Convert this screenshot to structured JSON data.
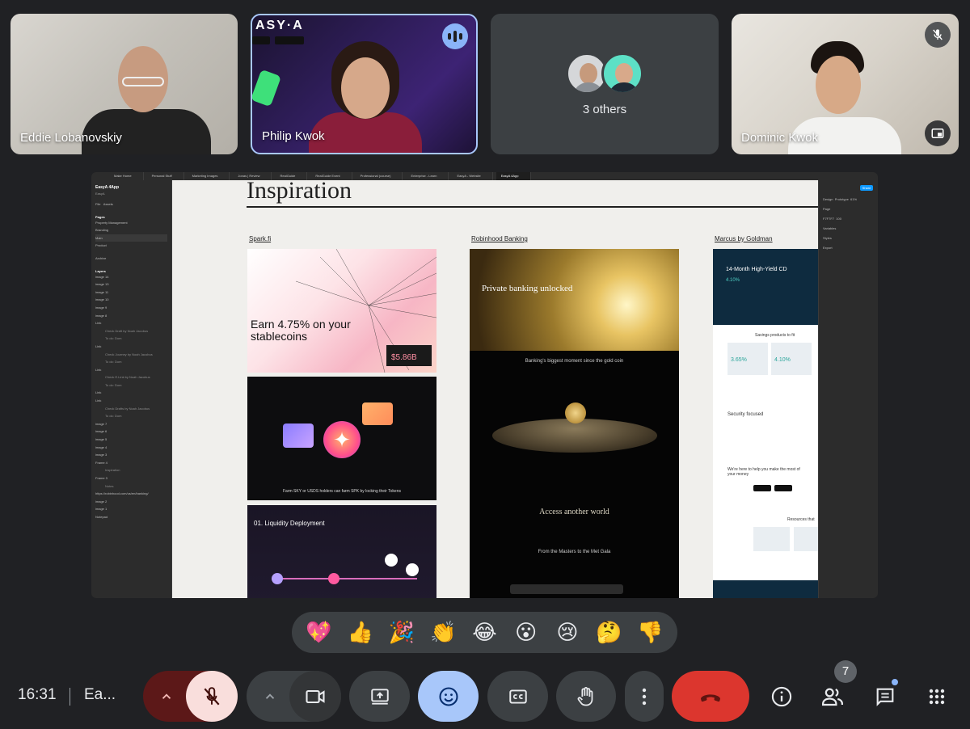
{
  "participants": [
    {
      "name": "Eddie Lobanovskiy"
    },
    {
      "name": "Philip Kwok",
      "banner": "ASY·A"
    },
    {
      "label": "3 others"
    },
    {
      "name": "Dominic Kwok"
    }
  ],
  "presentation": {
    "tabs": [
      "Make Home",
      "Personal Stuff",
      "Marketing Images",
      "Jonas | Review",
      "RealGuide",
      "RealGuide Event",
      "Professional (course)",
      "Enterprise - Learn",
      "EasyA - Website",
      "EasyA 4App"
    ],
    "file": {
      "title": "EasyA 4App",
      "subtitle": "EasyA"
    },
    "left_panel": {
      "tabs": [
        "File",
        "Assets"
      ],
      "pages_label": "Pages",
      "pages": [
        "Property Management",
        "Branding",
        "Main",
        "Product"
      ],
      "archive": "Archive",
      "layers_label": "Layers",
      "layers": [
        "image 14",
        "image 13",
        "image 11",
        "image 10",
        "image 9",
        "image 8",
        "Link",
        "Check Draft by Noah Jacobus",
        "To do: Dom",
        "Link",
        "Check Journey by Noah Jacobus",
        "To do: Dom",
        "Link",
        "Check E.Link by Noah Jacobus",
        "To do: Dom",
        "Link",
        "Link",
        "Check Drafts by Noah Jacobus",
        "To do: Dom",
        "image 7",
        "image 6",
        "image 5",
        "image 4",
        "image 3",
        "Frame 4",
        "Inspiration",
        "Frame 3",
        "Notes",
        "https://robinhood.com/us/en/banking/",
        "image 2",
        "image 1",
        "Notepad"
      ]
    },
    "right_panel": {
      "tabs": [
        "Design",
        "Prototype"
      ],
      "zoom": "61%",
      "share": "Share",
      "rows": [
        "Page",
        "F7F7F7",
        "100",
        "Variables",
        "Styles",
        "Export"
      ]
    },
    "canvas": {
      "title": "Inspiration",
      "columns": [
        {
          "label": "Spark.fi"
        },
        {
          "label": "Robinhood Banking"
        },
        {
          "label": "Marcus by Goldman"
        }
      ],
      "spark": {
        "hero": "Earn 4.75% on your stablecoins",
        "value": "$5.86B",
        "caption": "Farm SKY or USDS holders can farm SPK by locking their Tokens",
        "section": "01. Liquidity Deployment"
      },
      "robinhood": {
        "hero": "Private banking unlocked",
        "moment": "Banking's biggest moment since the gold coin",
        "access": "Access another world",
        "footer": "From the Masters to the Met Gala"
      },
      "marcus": {
        "hero": "14-Month High-Yield CD",
        "rate": "4.10%",
        "rate_alt": "3.65%",
        "rate_alt2": "4.10%",
        "savings": "Savings products to fit",
        "security": "Security focused",
        "help": "We're here to help you make the most of your money",
        "resources": "Resources that"
      }
    }
  },
  "reactions": [
    "💖",
    "👍",
    "🎉",
    "👏",
    "😂",
    "😮",
    "😢",
    "🤔",
    "👎"
  ],
  "bottom_bar": {
    "time": "16:31",
    "meeting": "Ea..."
  },
  "people_count": "7",
  "colors": {
    "background": "#202124",
    "speaking_border": "#a8c7fa",
    "leave": "#dc362e",
    "emoji_active": "#a8c7fa",
    "mic_off": "#f9dedc"
  }
}
